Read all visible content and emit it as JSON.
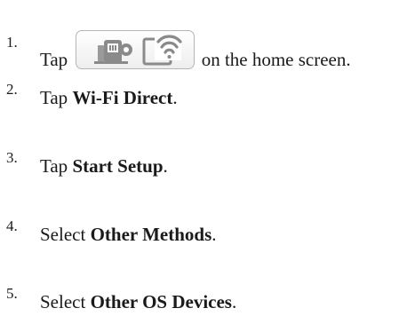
{
  "steps": [
    {
      "number": "1.",
      "prefix": "Tap",
      "suffix": "on the home screen.",
      "icons": [
        "printer-network-icon",
        "wifi-tablet-icon"
      ]
    },
    {
      "number": "2.",
      "prefix": "Tap ",
      "bold": "Wi-Fi Direct",
      "suffix": "."
    },
    {
      "number": "3.",
      "prefix": "Tap ",
      "bold": "Start Setup",
      "suffix": "."
    },
    {
      "number": "4.",
      "prefix": "Select ",
      "bold": "Other Methods",
      "suffix": "."
    },
    {
      "number": "5.",
      "prefix": "Select ",
      "bold": "Other OS Devices",
      "suffix": "."
    }
  ]
}
